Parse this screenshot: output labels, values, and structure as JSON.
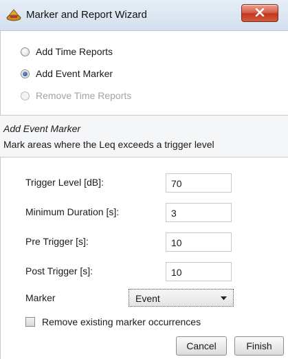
{
  "window": {
    "title": "Marker and Report Wizard",
    "icon": "wizard-hat-icon",
    "close_icon": "close-icon",
    "accent": "#c4361e"
  },
  "options": {
    "add_time_reports": "Add Time Reports",
    "add_event_marker": "Add Event Marker",
    "remove_time_reports": "Remove Time Reports",
    "selected": "Add Event Marker"
  },
  "info": {
    "title": "Add Event Marker",
    "description": "Mark areas where the Leq exceeds a trigger level"
  },
  "form": {
    "trigger_level_label": "Trigger Level [dB]:",
    "trigger_level_value": "70",
    "min_duration_label": "Minimum Duration [s]:",
    "min_duration_value": "3",
    "pre_trigger_label": "Pre Trigger [s]:",
    "pre_trigger_value": "10",
    "post_trigger_label": "Post Trigger [s]:",
    "post_trigger_value": "10",
    "marker_label": "Marker",
    "marker_value": "Event",
    "remove_existing_label": "Remove existing marker occurrences",
    "remove_existing_checked": false
  },
  "buttons": {
    "cancel": "Cancel",
    "finish": "Finish"
  }
}
